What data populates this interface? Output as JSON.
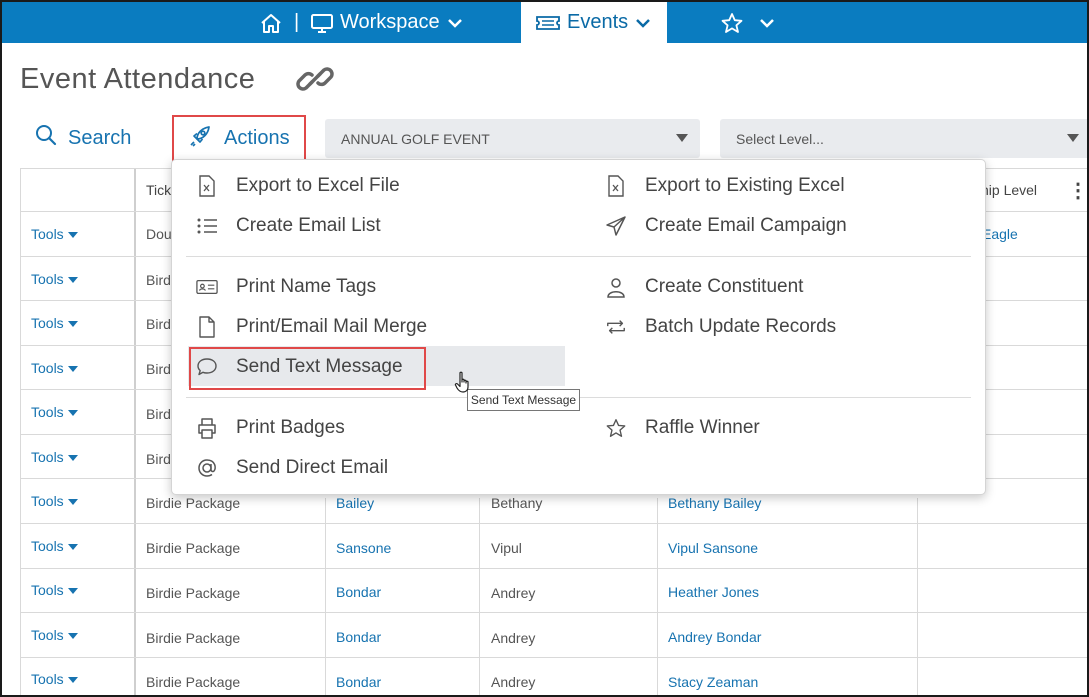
{
  "nav": {
    "separator": "|",
    "workspace_label": "Workspace",
    "events_label": "Events"
  },
  "page": {
    "title": "Event Attendance"
  },
  "toolbar": {
    "search_label": "Search",
    "actions_label": "Actions",
    "event_select_value": "ANNUAL GOLF EVENT",
    "level_select_placeholder": "Select Level..."
  },
  "table": {
    "header_partial_ticket": "Tick",
    "header_partial_level": "ship Level",
    "tools_label": "Tools",
    "rows": [
      {
        "ticket": "Dou",
        "last": "",
        "first": "",
        "name": "",
        "level": "Eagle"
      },
      {
        "ticket": "Bird",
        "last": "",
        "first": "",
        "name": "",
        "level": ""
      },
      {
        "ticket": "Bird",
        "last": "",
        "first": "",
        "name": "",
        "level": ""
      },
      {
        "ticket": "Bird",
        "last": "",
        "first": "",
        "name": "",
        "level": ""
      },
      {
        "ticket": "Bird",
        "last": "",
        "first": "",
        "name": "",
        "level": ""
      },
      {
        "ticket": "Bird",
        "last": "",
        "first": "",
        "name": "",
        "level": ""
      },
      {
        "ticket": "Birdie Package",
        "last": "Bailey",
        "first": "Bethany",
        "name": "Bethany Bailey",
        "level": ""
      },
      {
        "ticket": "Birdie Package",
        "last": "Sansone",
        "first": "Vipul",
        "name": "Vipul Sansone",
        "level": ""
      },
      {
        "ticket": "Birdie Package",
        "last": "Bondar",
        "first": "Andrey",
        "name": "Heather Jones",
        "level": ""
      },
      {
        "ticket": "Birdie Package",
        "last": "Bondar",
        "first": "Andrey",
        "name": "Andrey Bondar",
        "level": ""
      },
      {
        "ticket": "Birdie Package",
        "last": "Bondar",
        "first": "Andrey",
        "name": "Stacy Zeaman",
        "level": ""
      }
    ]
  },
  "menu": {
    "export_excel": "Export to Excel File",
    "export_existing": "Export to Existing Excel",
    "create_email_list": "Create Email List",
    "create_email_campaign": "Create Email Campaign",
    "print_name_tags": "Print Name Tags",
    "create_constituent": "Create Constituent",
    "print_email_merge": "Print/Email Mail Merge",
    "batch_update": "Batch Update Records",
    "send_text": "Send Text Message",
    "print_badges": "Print Badges",
    "raffle_winner": "Raffle Winner",
    "send_direct_email": "Send Direct Email"
  },
  "tooltip": "Send Text Message",
  "colors": {
    "nav_bg": "#0a7cc0",
    "link": "#1773b0",
    "highlight_border": "#e04848"
  }
}
